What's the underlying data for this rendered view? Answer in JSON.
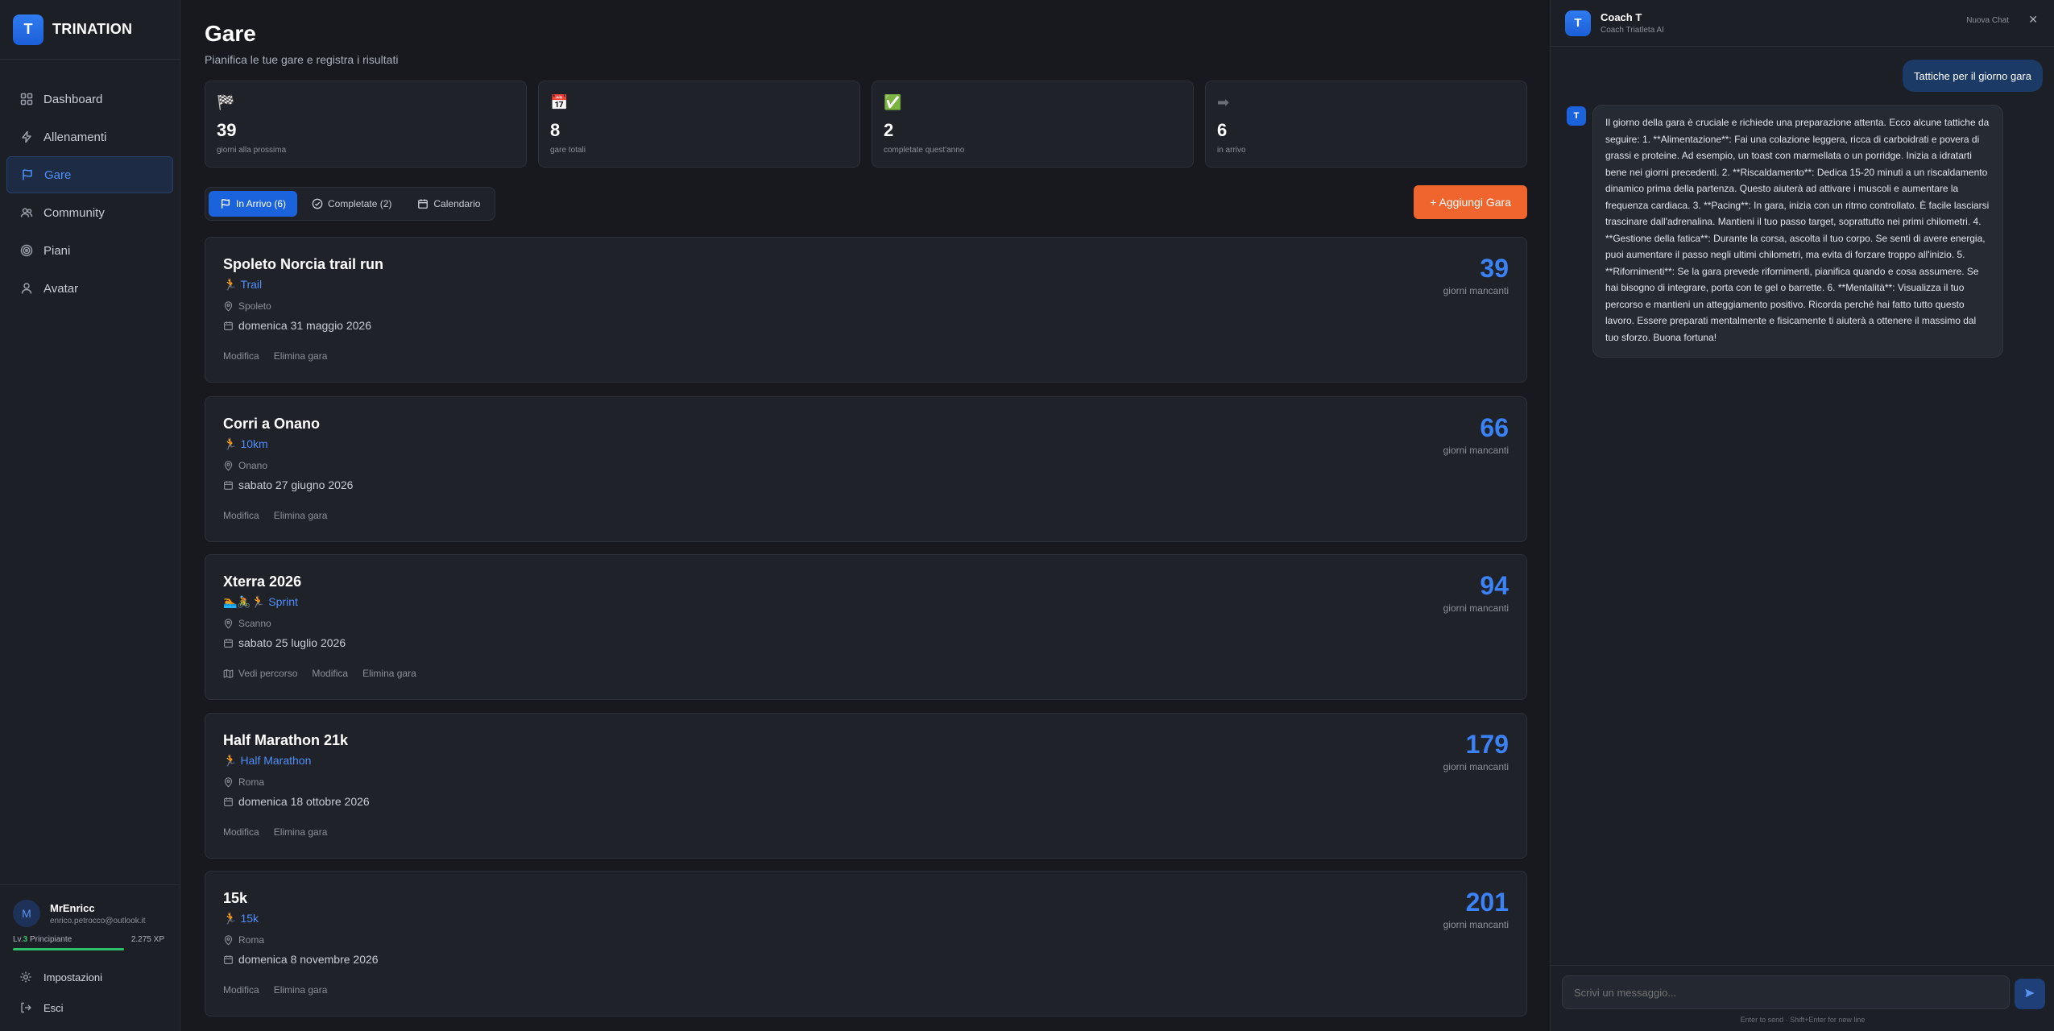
{
  "brand": {
    "logo_letter": "T",
    "name": "TRINATION"
  },
  "nav": [
    {
      "label": "Dashboard",
      "icon": "grid-icon"
    },
    {
      "label": "Allenamenti",
      "icon": "bolt-icon"
    },
    {
      "label": "Gare",
      "icon": "flag-icon",
      "active": true
    },
    {
      "label": "Community",
      "icon": "users-icon"
    },
    {
      "label": "Piani",
      "icon": "target-icon"
    },
    {
      "label": "Avatar",
      "icon": "user-icon"
    }
  ],
  "user": {
    "initial": "M",
    "name": "MrEnricc",
    "email": "enrico.petrocco@outlook.it",
    "level_prefix": "Lv.",
    "level": "3",
    "level_name": "Principiante",
    "xp": "2.275 XP",
    "xp_progress": 1.0
  },
  "footer_nav": [
    {
      "label": "Impostazioni",
      "icon": "gear-icon"
    },
    {
      "label": "Esci",
      "icon": "logout-icon"
    }
  ],
  "page": {
    "title": "Gare",
    "subtitle": "Pianifica le tue gare e registra i risultati"
  },
  "stats": [
    {
      "icon": "🏁",
      "value": "39",
      "label": "giorni alla prossima"
    },
    {
      "icon": "📅",
      "value": "8",
      "label": "gare totali"
    },
    {
      "icon": "✅",
      "value": "2",
      "label": "completate quest'anno"
    },
    {
      "icon": "➡",
      "value": "6",
      "label": "in arrivo"
    }
  ],
  "tabs": [
    {
      "label": "In Arrivo (6)",
      "active": true
    },
    {
      "label": "Completate (2)"
    },
    {
      "label": "Calendario"
    }
  ],
  "add_button": "+ Aggiungi Gara",
  "races": [
    {
      "name": "Spoleto Norcia trail run",
      "emoji": "🏃",
      "category": "Trail",
      "location": "Spoleto",
      "date": "domenica 31 maggio 2026",
      "actions": [
        "Modifica",
        "Elimina gara"
      ],
      "days": "39",
      "days_label": "giorni mancanti"
    },
    {
      "name": "Corri a Onano",
      "emoji": "🏃",
      "category": "10km",
      "location": "Onano",
      "date": "sabato 27 giugno 2026",
      "actions": [
        "Modifica",
        "Elimina gara"
      ],
      "days": "66",
      "days_label": "giorni mancanti"
    },
    {
      "name": "Xterra 2026",
      "emoji": "🏊🚴🏃",
      "category": "Sprint",
      "location": "Scanno",
      "date": "sabato 25 luglio 2026",
      "actions": [
        "Vedi percorso",
        "Modifica",
        "Elimina gara"
      ],
      "days": "94",
      "days_label": "giorni mancanti"
    },
    {
      "name": "Half Marathon 21k",
      "emoji": "🏃",
      "category": "Half Marathon",
      "location": "Roma",
      "date": "domenica 18 ottobre 2026",
      "actions": [
        "Modifica",
        "Elimina gara"
      ],
      "days": "179",
      "days_label": "giorni mancanti"
    },
    {
      "name": "15k",
      "emoji": "🏃",
      "category": "15k",
      "location": "Roma",
      "date": "domenica 8 novembre 2026",
      "actions": [
        "Modifica",
        "Elimina gara"
      ],
      "days": "201",
      "days_label": "giorni mancanti"
    }
  ],
  "chat": {
    "logo_letter": "T",
    "title": "Coach T",
    "subtitle": "Coach Triatleta AI",
    "new_chat": "Nuova Chat",
    "close": "✕",
    "user_message": "Tattiche per il giorno gara",
    "bot_initial": "T",
    "bot_message": "Il giorno della gara è cruciale e richiede una preparazione attenta. Ecco alcune tattiche da seguire: 1. **Alimentazione**: Fai una colazione leggera, ricca di carboidrati e povera di grassi e proteine. Ad esempio, un toast con marmellata o un porridge. Inizia a idratarti bene nei giorni precedenti. 2. **Riscaldamento**: Dedica 15-20 minuti a un riscaldamento dinamico prima della partenza. Questo aiuterà ad attivare i muscoli e aumentare la frequenza cardiaca. 3. **Pacing**: In gara, inizia con un ritmo controllato. È facile lasciarsi trascinare dall'adrenalina. Mantieni il tuo passo target, soprattutto nei primi chilometri. 4. **Gestione della fatica**: Durante la corsa, ascolta il tuo corpo. Se senti di avere energia, puoi aumentare il passo negli ultimi chilometri, ma evita di forzare troppo all'inizio. 5. **Rifornimenti**: Se la gara prevede rifornimenti, pianifica quando e cosa assumere. Se hai bisogno di integrare, porta con te gel o barrette. 6. **Mentalità**: Visualizza il tuo percorso e mantieni un atteggiamento positivo. Ricorda perché hai fatto tutto questo lavoro. Essere preparati mentalmente e fisicamente ti aiuterà a ottenere il massimo dal tuo sforzo. Buona fortuna!",
    "input_placeholder": "Scrivi un messaggio...",
    "hint": "Enter to send · Shift+Enter for new line"
  },
  "colors": {
    "accent": "#3a82f5",
    "orange": "#f0642e",
    "background": "#17191f",
    "panel": "#1f2229"
  }
}
